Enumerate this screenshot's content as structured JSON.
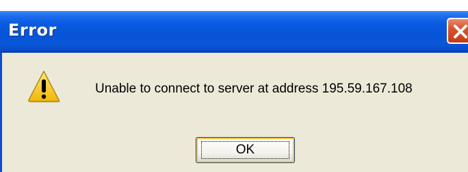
{
  "dialog": {
    "title": "Error",
    "message": "Unable to connect to server at address 195.59.167.108",
    "ok_label": "OK",
    "icons": {
      "warning": "warning-icon",
      "close": "close-icon"
    }
  },
  "colors": {
    "titlebar": "#0854d6",
    "dialog_background": "#ece9d8",
    "close_button": "#d9532c",
    "warning_fill": "#f5c518"
  }
}
